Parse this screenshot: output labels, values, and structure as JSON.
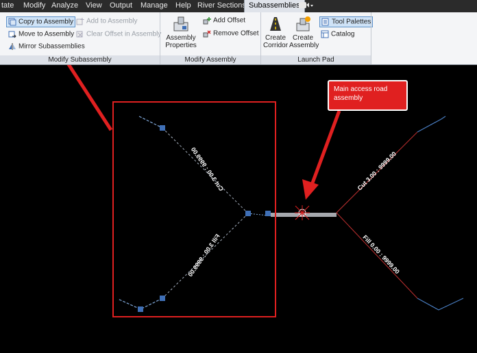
{
  "menubar": {
    "tabs": [
      "tate",
      "Modify",
      "Analyze",
      "View",
      "Output",
      "Manage",
      "Help",
      "River Sections",
      "Subassemblies"
    ],
    "extra": "▾"
  },
  "ribbon": {
    "modify_subassembly": {
      "title": "Modify Subassembly",
      "copy": "Copy to Assembly",
      "add": "Add to Assembly",
      "move": "Move to Assembly",
      "clear": "Clear Offset in Assembly",
      "mirror": "Mirror Subassemblies"
    },
    "modify_assembly": {
      "title": "Modify Assembly",
      "properties_1": "Assembly",
      "properties_2": "Properties",
      "add_offset": "Add Offset",
      "remove_offset": "Remove Offset"
    },
    "launch_pad": {
      "title": "Launch Pad",
      "create_corridor_1": "Create",
      "create_corridor_2": "Corridor",
      "create_assembly_1": "Create",
      "create_assembly_2": "Assembly",
      "tool_palettes": "Tool Palettes",
      "catalog": "Catalog"
    }
  },
  "drawing": {
    "left_upper_label": "Cut 3.00 : 9999.00",
    "left_lower_label": "Fill 3.00 : 9999.00",
    "right_upper_label": "Cut 3.00 : 9999.00",
    "right_lower_label": "Fill 0.00 : 9999.00"
  },
  "callout": {
    "line1": "Main access road",
    "line2": "assembly"
  },
  "colors": {
    "annotation_red": "#e02020",
    "grip_blue": "#3f6fb5",
    "highlight": "#cfe3f7"
  }
}
